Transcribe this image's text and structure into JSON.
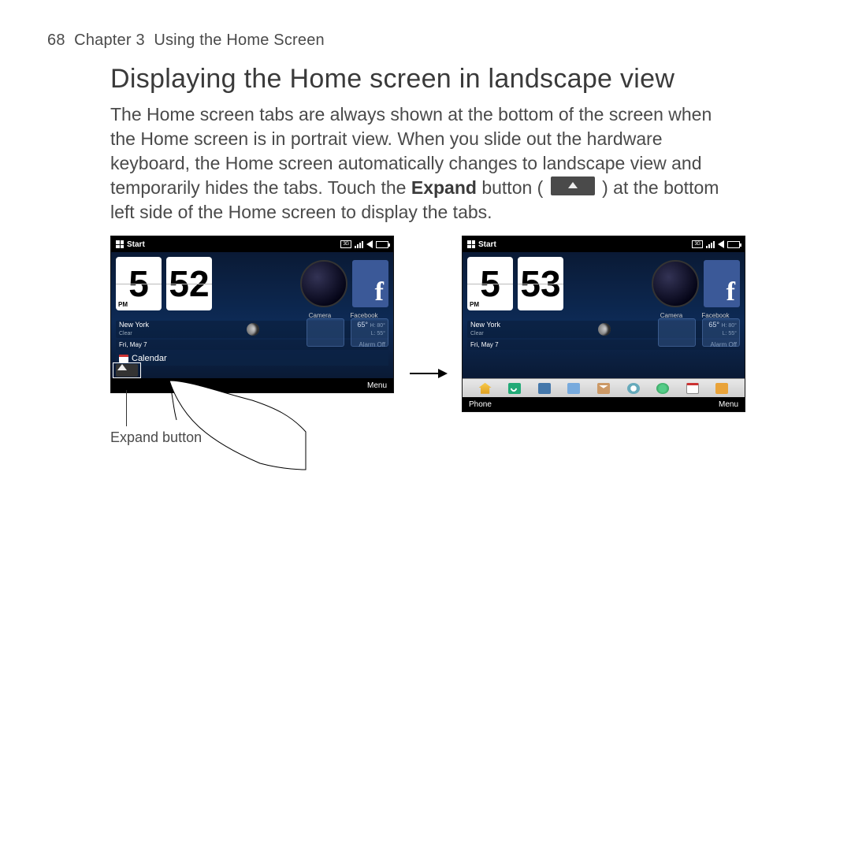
{
  "header": {
    "page": "68",
    "chapter": "Chapter 3",
    "title": "Using the Home Screen"
  },
  "section_title": "Displaying the Home screen in landscape view",
  "paragraph": {
    "p1": "The Home screen tabs are always shown at the bottom of the screen when the Home screen is in portrait view. When you slide out the hardware keyboard, the Home screen automatically changes to landscape view and temporarily hides the tabs. Touch the ",
    "expand_bold": "Expand",
    "p2": " button ( ",
    "p3": " ) at the bottom left side of the Home screen to display the tabs."
  },
  "caption": "Expand button",
  "left": {
    "start": "Start",
    "net": "3G",
    "hour": "5",
    "minute": "52",
    "ampm": "PM",
    "cam": "Camera",
    "fb": "Facebook",
    "city": "New York",
    "cond": "Clear",
    "temp": "65°",
    "hi": "H: 80°",
    "lo": "L: 55°",
    "date": "Fri, May 7",
    "alarm": "Alarm Off",
    "calendar": "Calendar",
    "menu": "Menu"
  },
  "right": {
    "start": "Start",
    "net": "3G",
    "hour": "5",
    "minute": "53",
    "ampm": "PM",
    "cam": "Camera",
    "fb": "Facebook",
    "city": "New York",
    "cond": "Clear",
    "temp": "65°",
    "hi": "H: 80°",
    "lo": "L: 55°",
    "date": "Fri, May 7",
    "alarm": "Alarm Off",
    "phone": "Phone",
    "menu": "Menu"
  }
}
